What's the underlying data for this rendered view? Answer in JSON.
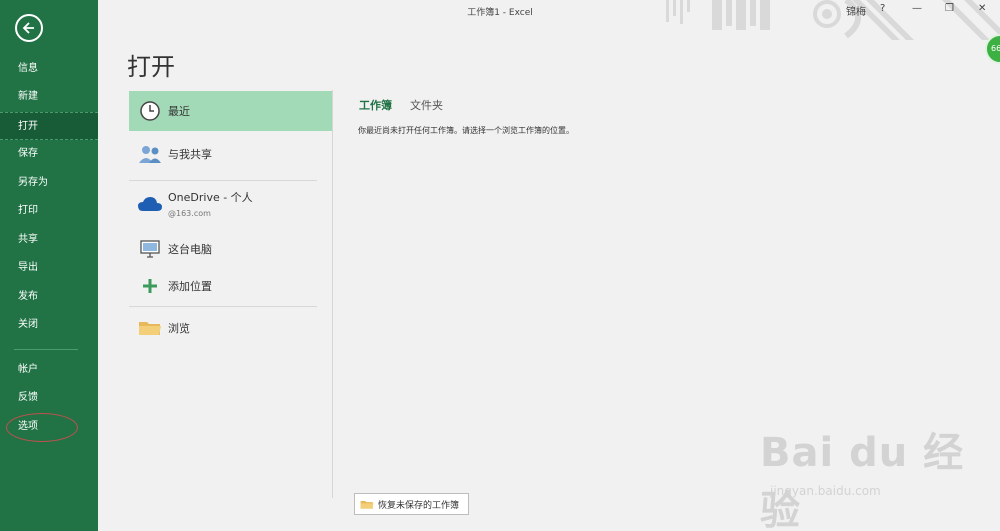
{
  "window": {
    "title": "工作簿1  -  Excel",
    "user": "锦梅",
    "help": "?",
    "minimize": "—",
    "restore": "❐",
    "close": "✕",
    "badge": "66"
  },
  "sidebar": {
    "back_icon": "back-arrow-icon",
    "items": [
      {
        "label": "信息"
      },
      {
        "label": "新建"
      },
      {
        "label": "打开",
        "active": true
      },
      {
        "label": "保存"
      },
      {
        "label": "另存为"
      },
      {
        "label": "打印"
      },
      {
        "label": "共享"
      },
      {
        "label": "导出"
      },
      {
        "label": "发布"
      },
      {
        "label": "关闭"
      },
      {
        "label": "帐户"
      },
      {
        "label": "反馈"
      },
      {
        "label": "选项"
      }
    ]
  },
  "page": {
    "title": "打开"
  },
  "locations": [
    {
      "label": "最近",
      "icon": "clock-icon",
      "selected": true
    },
    {
      "label": "与我共享",
      "icon": "people-icon"
    },
    {
      "label": "OneDrive - 个人",
      "sub": "@163.com",
      "icon": "cloud-icon"
    },
    {
      "label": "这台电脑",
      "icon": "computer-icon"
    },
    {
      "label": "添加位置",
      "icon": "plus-icon"
    },
    {
      "label": "浏览",
      "icon": "folder-icon"
    }
  ],
  "panel": {
    "tabs": [
      {
        "label": "工作簿",
        "active": true
      },
      {
        "label": "文件夹"
      }
    ],
    "empty_message": "你最近尚未打开任何工作簿。请选择一个浏览工作簿的位置。",
    "recover_label": "恢复未保存的工作簿"
  },
  "watermark": {
    "brand": "Bai du 经验",
    "url": "jingyan.baidu.com"
  },
  "colors": {
    "accent": "#217346",
    "selected": "#a2d9b6"
  }
}
